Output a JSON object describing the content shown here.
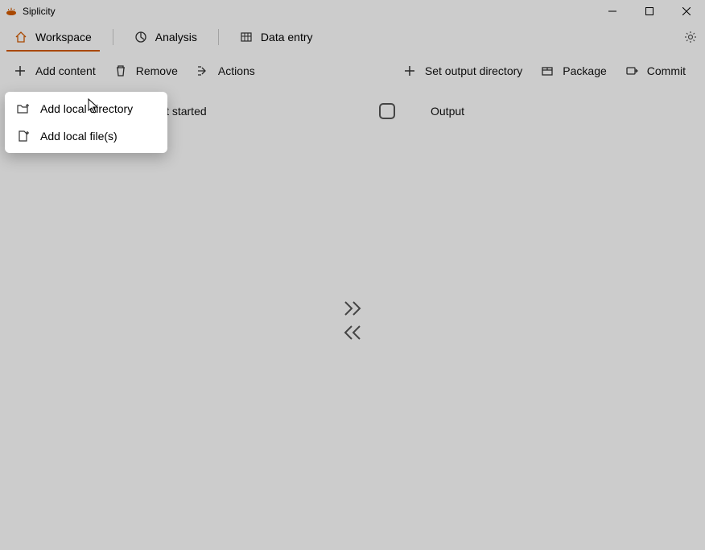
{
  "app": {
    "title": "Siplicity"
  },
  "tabs": {
    "workspace": "Workspace",
    "analysis": "Analysis",
    "data_entry": "Data entry"
  },
  "toolbar_left": {
    "add_content": "Add content",
    "remove": "Remove",
    "actions": "Actions"
  },
  "toolbar_right": {
    "set_output": "Set output directory",
    "package": "Package",
    "commit": "Commit"
  },
  "panes": {
    "left_title": "Drop files here to get started",
    "right_title": "Output"
  },
  "menu": {
    "add_dir": "Add local directory",
    "add_files": "Add local file(s)"
  }
}
